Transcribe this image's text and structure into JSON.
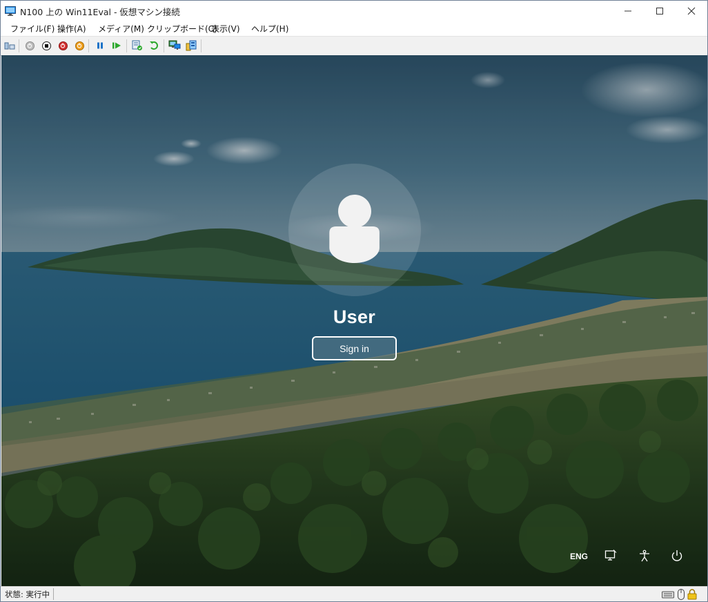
{
  "window": {
    "title": "N100 上の Win11Eval - 仮想マシン接続",
    "controls": {
      "minimize": "—",
      "maximize": "☐",
      "close": "✕"
    }
  },
  "menu": [
    {
      "label": "ファイル(F)"
    },
    {
      "label": "操作(A)"
    },
    {
      "label": "メディア(M)"
    },
    {
      "label": "クリップボード(C)"
    },
    {
      "label": "表示(V)"
    },
    {
      "label": "ヘルプ(H)"
    }
  ],
  "toolbar": {
    "icons": [
      "ctrl-alt-del-icon",
      "start-icon",
      "turn-off-icon",
      "shut-down-icon",
      "save-icon",
      "pause-icon",
      "resume-icon",
      "checkpoint-icon",
      "revert-icon",
      "enhanced-session-icon",
      "share-icon"
    ],
    "colors": {
      "stop": "#d32f2f",
      "save": "#f0a020",
      "play": "#2da82d",
      "pause": "#1a73c8"
    }
  },
  "lock_screen": {
    "user_name": "User",
    "sign_in_label": "Sign in",
    "language": "ENG",
    "icons": [
      "network-icon",
      "accessibility-icon",
      "power-icon"
    ]
  },
  "status": {
    "text": "状態: 実行中",
    "icons": [
      "keyboard-icon",
      "mouse-icon",
      "lock-icon"
    ]
  }
}
